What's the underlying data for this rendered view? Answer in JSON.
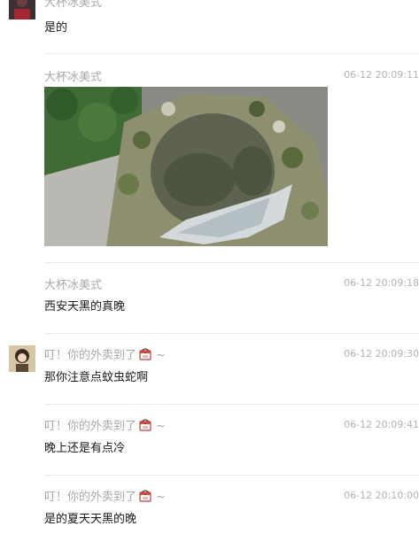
{
  "messages": [
    {
      "sender": "大杯冰美式",
      "time": "",
      "text": "是的"
    },
    {
      "sender": "大杯冰美式",
      "time": "06-12 20:09:11",
      "text": ""
    },
    {
      "sender": "大杯冰美式",
      "time": "06-12 20:09:18",
      "text": "西安天黑的真晚"
    },
    {
      "sender": "叮！你的外卖到了",
      "suffix": "~",
      "time": "06-12 20:09:30",
      "text": "那你注意点蚊虫蛇啊"
    },
    {
      "sender": "叮！你的外卖到了",
      "suffix": "~",
      "time": "06-12 20:09:41",
      "text": "晚上还是有点冷"
    },
    {
      "sender": "叮！你的外卖到了",
      "suffix": "~",
      "time": "06-12 20:10:00",
      "text": "是的夏天天黑的晚"
    }
  ],
  "icons": {
    "avatar_1": "avatar-dark",
    "avatar_2": "avatar-girl-photo",
    "takeout_emoji": "takeout-box-emoji"
  },
  "colors": {
    "nickname": "#a8a8a8",
    "timestamp": "#b3b3b3",
    "message_text": "#1a1a1a",
    "separator": "#ececec"
  }
}
